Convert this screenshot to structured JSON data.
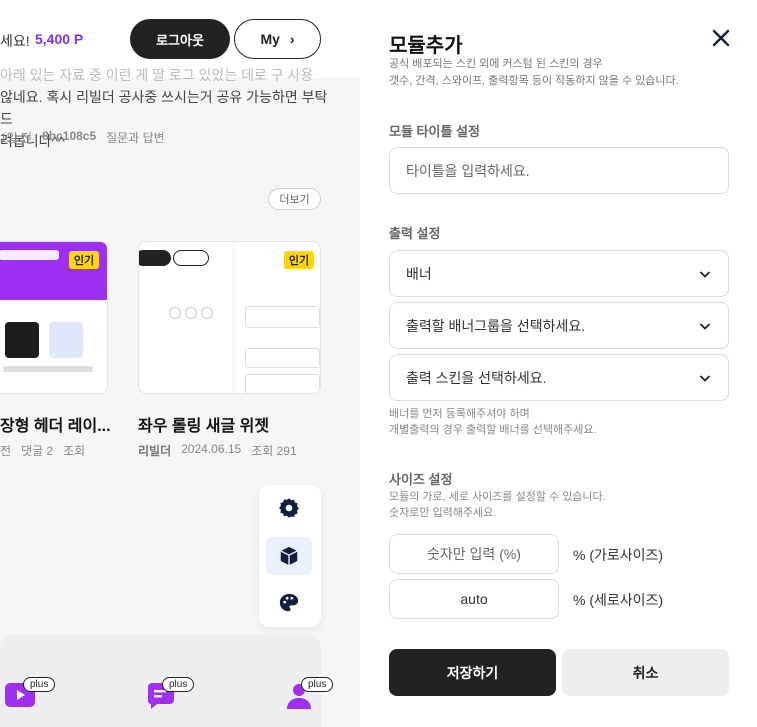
{
  "background": {
    "header": {
      "greeting_tail": "세요!",
      "points": "5,400 P",
      "logout_label": "로그아웃",
      "my_label": "My",
      "my_chevron_glyph": "›"
    },
    "post": {
      "line1": "아래 있는 자료 중 이런 게 딸 로그 있었는 데로 구 사용",
      "line2": "않네요. 혹시 리빌더 공사중 쓰시는거 공유 가능하면 부탁드",
      "line3": "려봅니다^^",
      "meta_time": "1일 전",
      "meta_id": "8bc108c5",
      "meta_category": "질문과 답변"
    },
    "more_label": "더보기",
    "cards": [
      {
        "badge": "인기",
        "title": "장형 헤더 레이...",
        "meta_prefix": "전",
        "comments": "댓글 2",
        "views": "조회"
      },
      {
        "badge": "인기",
        "title": "좌우 롤링 새글 위젯",
        "author": "리빌더",
        "date": "2024.06.15",
        "views": "조회 291"
      }
    ],
    "plus_label": "plus"
  },
  "modal": {
    "title": "모듈추가",
    "desc_line1": "공식 배포되는 스킨 외에 커스텀 된 스킨의 경우",
    "desc_line2": "갯수, 간격, 스와이프, 출력항목 등이 작동하지 않을 수 있습니다.",
    "title_section": "모듈 타이틀 설정",
    "title_placeholder": "타이틀을 입력하세요.",
    "output_section": "출력 설정",
    "output_type": "배너",
    "banner_group_placeholder": "출력할 배너그룹을 선택하세요.",
    "skin_placeholder": "출력 스킨을 선택하세요.",
    "output_hint_line1": "배너를 먼저 등록해주셔야 하며",
    "output_hint_line2": "개별출력의 경우 출력할 배너를 선택해주세요.",
    "size_section": "사이즈 설정",
    "size_hint_line1": "모듈의 가로, 세로 사이즈를 설정할 수 있습니다.",
    "size_hint_line2": "숫자로만 입력해주세요.",
    "width_placeholder": "숫자만 입력 (%)",
    "width_unit": "% (가로사이즈)",
    "height_value": "auto",
    "height_unit": "% (세로사이즈)",
    "save_label": "저장하기",
    "cancel_label": "취소"
  },
  "colors": {
    "accent_purple": "#7b2ff7",
    "badge_yellow": "#ffd600",
    "dark": "#222222"
  },
  "icons": [
    "gear-icon",
    "cube-icon",
    "palette-icon",
    "close-icon",
    "chevron-down-icon",
    "chevron-right-icon",
    "play-icon",
    "chat-icon",
    "users-icon"
  ]
}
